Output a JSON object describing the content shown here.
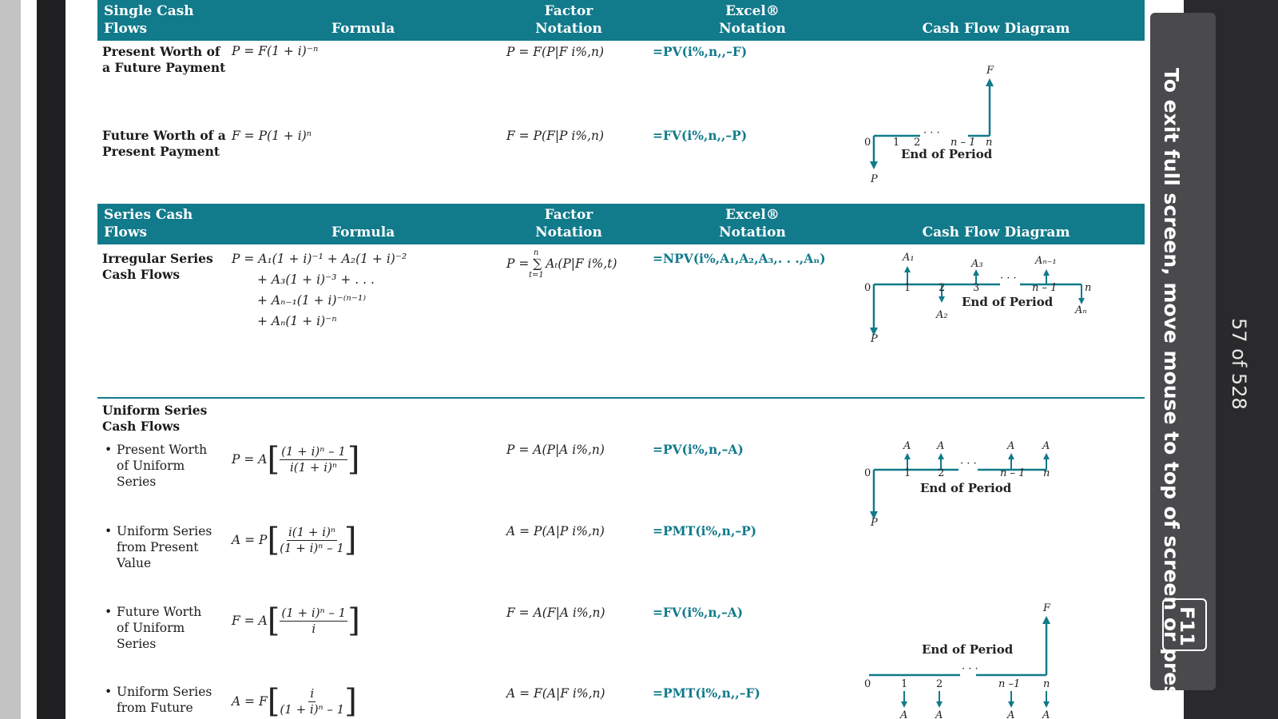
{
  "headers": {
    "single": {
      "title_line1": "Single Cash",
      "title_line2": "Flows",
      "formula": "Formula",
      "factor_line1": "Factor",
      "factor_line2": "Notation",
      "excel_line1": "Excel®",
      "excel_line2": "Notation",
      "diagram": "Cash Flow Diagram"
    },
    "series": {
      "title_line1": "Series Cash",
      "title_line2": "Flows",
      "formula": "Formula",
      "factor_line1": "Factor",
      "factor_line2": "Notation",
      "excel_line1": "Excel®",
      "excel_line2": "Notation",
      "diagram": "Cash Flow Diagram"
    }
  },
  "rows": {
    "pw_future": {
      "label_line1": "Present Worth of",
      "label_line2": "a Future Payment",
      "formula": "P = F(1 + i)⁻ⁿ",
      "factor": "P = F(P|F i%,n)",
      "excel": "=PV(i%,n,,–F)"
    },
    "fw_present": {
      "label_line1": "Future Worth of a",
      "label_line2": "Present Payment",
      "formula": "F = P(1 + i)ⁿ",
      "factor": "F = P(F|P i%,n)",
      "excel": "=FV(i%,n,,–P)"
    },
    "irregular": {
      "label_line1": "Irregular Series",
      "label_line2": "Cash Flows",
      "formula_l1": "P = A₁(1 + i)⁻¹ + A₂(1 + i)⁻²",
      "formula_l2": "+ A₃(1 + i)⁻³ + . . .",
      "formula_l3": "+ Aₙ₋₁(1 + i)⁻⁽ⁿ⁻¹⁾",
      "formula_l4": "+ Aₙ(1 + i)⁻ⁿ",
      "factor": "P = ∑ Aₜ(P|F i%,t)",
      "factor_top": "n",
      "factor_bottom": "t=1",
      "excel": "=NPV(i%,A₁,A₂,A₃,. . .,Aₙ)"
    },
    "uniform_title": {
      "line1": "Uniform Series",
      "line2": "Cash Flows"
    },
    "pw_uniform": {
      "line1": "Present Worth",
      "line2": "of Uniform",
      "line3": "Series",
      "lhs": "P = A",
      "num": "(1 + i)ⁿ – 1",
      "den": "i(1 + i)ⁿ",
      "factor": "P = A(P|A i%,n)",
      "excel": "=PV(i%,n,–A)"
    },
    "us_present": {
      "line1": "Uniform Series",
      "line2": "from Present",
      "line3": "Value",
      "lhs": "A = P",
      "num": "i(1 + i)ⁿ",
      "den": "(1 + i)ⁿ – 1",
      "factor": "A = P(A|P i%,n)",
      "excel": "=PMT(i%,n,–P)"
    },
    "fw_uniform": {
      "line1": "Future Worth",
      "line2": "of Uniform",
      "line3": "Series",
      "lhs": "F = A",
      "num": "(1 + i)ⁿ – 1",
      "den": "i",
      "factor": "F = A(F|A i%,n)",
      "excel": "=FV(i%,n,–A)"
    },
    "us_future": {
      "line1": "Uniform Series",
      "line2": "from Future",
      "lhs": "A = F",
      "num": "i",
      "den": "(1 + i)ⁿ – 1",
      "factor": "A = F(A|F i%,n)",
      "excel": "=PMT(i%,n,,–F)"
    }
  },
  "diagrams": {
    "single": {
      "F": "F",
      "P": "P",
      "zero": "0",
      "t1": "1",
      "t2": "2",
      "dots": "· · ·",
      "tn1": "n – 1",
      "tn": "n",
      "eop": "End of Period"
    },
    "irregular": {
      "A1": "A₁",
      "A2": "A₂",
      "A3": "A₃",
      "An1": "Aₙ₋₁",
      "An": "Aₙ",
      "P": "P",
      "zero": "0",
      "t1": "1",
      "t2": "2",
      "t3": "3",
      "dots": "· · ·",
      "tn1": "n – 1",
      "tn": "n",
      "eop": "End of Period"
    },
    "uniform_pw": {
      "A": "A",
      "P": "P",
      "zero": "0",
      "t1": "1",
      "t2": "2",
      "dots": "· · ·",
      "tn1": "n – 1",
      "tn": "n",
      "eop": "End of Period"
    },
    "uniform_fw": {
      "F": "F",
      "A": "A",
      "zero": "0",
      "t1": "1",
      "t2": "2",
      "dots": "· · ·",
      "tn1": "n –1",
      "tn": "n",
      "eop": "End of Period"
    }
  },
  "overlay": {
    "exit_message": "To exit full screen, move mouse to top of screen or press",
    "exit_key": "F11",
    "page_count": "57 of 528"
  },
  "colors": {
    "accent": "#117a8b",
    "overlay_bg": "#4a4a4c"
  }
}
